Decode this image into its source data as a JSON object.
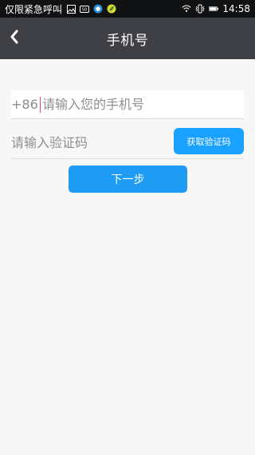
{
  "status_bar": {
    "left_text": "仅限紧急呼叫",
    "time": "14:58"
  },
  "header": {
    "title": "手机号"
  },
  "form": {
    "country_code": "+86",
    "phone_placeholder": "请输入您的手机号",
    "code_placeholder": "请输入验证码",
    "get_code_label": "获取验证码",
    "next_label": "下一步"
  },
  "icons": {
    "back": "back-icon",
    "image": "image-icon",
    "sim": "sim-icon",
    "shield": "shield-icon",
    "leaf": "leaf-icon",
    "wifi": "wifi-icon",
    "vibrate": "vibrate-icon",
    "battery": "battery-icon"
  },
  "colors": {
    "status_bar": "#111214",
    "header": "#3f4046",
    "primary": "#1aa0ff",
    "background": "#f7f7f7",
    "text_muted": "#8f8f8f",
    "cursor": "#e74867"
  }
}
